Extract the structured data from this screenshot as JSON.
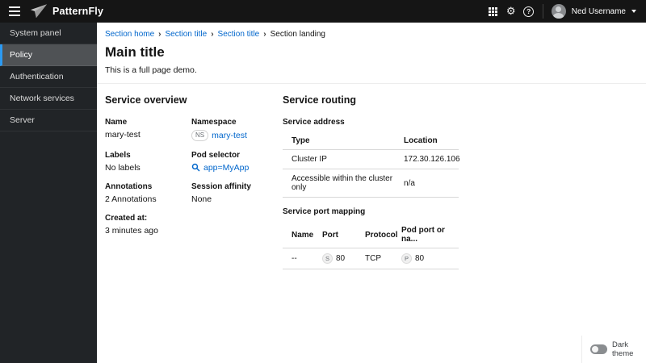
{
  "masthead": {
    "brand": "PatternFly",
    "settings_glyph": "⚙",
    "help_glyph": "?",
    "user": {
      "name": "Ned Username"
    }
  },
  "sidebar": {
    "items": [
      {
        "label": "System panel",
        "selected": false
      },
      {
        "label": "Policy",
        "selected": true
      },
      {
        "label": "Authentication",
        "selected": false
      },
      {
        "label": "Network services",
        "selected": false
      },
      {
        "label": "Server",
        "selected": false
      }
    ]
  },
  "breadcrumb": {
    "items": [
      {
        "label": "Section home",
        "link": true
      },
      {
        "label": "Section title",
        "link": true
      },
      {
        "label": "Section title",
        "link": true
      },
      {
        "label": "Section landing",
        "link": false
      }
    ],
    "separator": "›"
  },
  "page": {
    "title": "Main title",
    "subtitle": "This is a full page demo."
  },
  "overview": {
    "heading": "Service overview",
    "fields": [
      {
        "label": "Name",
        "value": "mary-test"
      },
      {
        "label": "Namespace",
        "badge": "NS",
        "value": "mary-test"
      },
      {
        "label": "Labels",
        "value": "No labels"
      },
      {
        "label": "Pod selector",
        "value": "app=MyApp"
      },
      {
        "label": "Annotations",
        "value": "2 Annotations"
      },
      {
        "label": "Session affinity",
        "value": "None"
      },
      {
        "label": "Created at:",
        "value": "3 minutes ago"
      }
    ]
  },
  "routing": {
    "heading": "Service routing",
    "address": {
      "heading": "Service address",
      "headers": [
        "Type",
        "Location"
      ],
      "rows": [
        [
          "Cluster IP",
          "172.30.126.106"
        ],
        [
          "Accessible within the cluster only",
          "n/a"
        ]
      ]
    },
    "ports": {
      "heading": "Service port mapping",
      "headers": [
        "Name",
        "Port",
        "Protocol",
        "Pod port or na..."
      ],
      "row": {
        "name": "--",
        "port_badge": "S",
        "port": "80",
        "protocol": "TCP",
        "pod_badge": "P",
        "pod_port": "80"
      }
    }
  },
  "theme": {
    "label": "Dark theme",
    "enabled": false
  },
  "colors": {
    "masthead_bg": "#151515",
    "sidebar_bg": "#212427",
    "sidebar_selected_bg": "#4f5255",
    "nav_accent": "#2b9af3",
    "link": "#0066cc",
    "border": "#d8d8d8"
  }
}
